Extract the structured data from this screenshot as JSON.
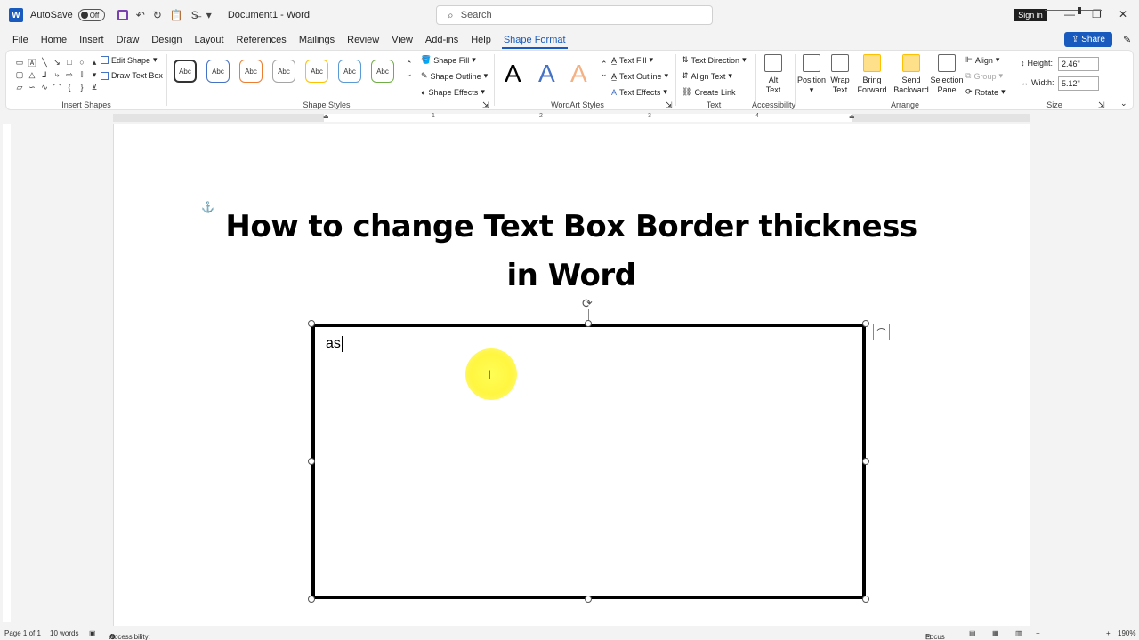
{
  "titlebar": {
    "autosave_label": "AutoSave",
    "autosave_state": "Off",
    "doc_title": "Document1 - Word",
    "search_placeholder": "Search",
    "sign_in": "Sign in"
  },
  "tabs": [
    "File",
    "Home",
    "Insert",
    "Draw",
    "Design",
    "Layout",
    "References",
    "Mailings",
    "Review",
    "View",
    "Add-ins",
    "Help",
    "Shape Format"
  ],
  "active_tab": "Shape Format",
  "share_label": "Share",
  "ribbon": {
    "insert_shapes": {
      "label": "Insert Shapes",
      "edit_shape": "Edit Shape",
      "draw_text_box": "Draw Text Box"
    },
    "shape_styles": {
      "label": "Shape Styles",
      "gallery": [
        "Abc",
        "Abc",
        "Abc",
        "Abc",
        "Abc",
        "Abc",
        "Abc"
      ],
      "shape_fill": "Shape Fill",
      "shape_outline": "Shape Outline",
      "shape_effects": "Shape Effects"
    },
    "wordart_styles": {
      "label": "WordArt Styles",
      "letters": [
        "A",
        "A",
        "A"
      ],
      "text_fill": "Text Fill",
      "text_outline": "Text Outline",
      "text_effects": "Text Effects"
    },
    "text": {
      "label": "Text",
      "text_direction": "Text Direction",
      "align_text": "Align Text",
      "create_link": "Create Link"
    },
    "accessibility": {
      "label": "Accessibility",
      "alt_text": "Alt Text"
    },
    "arrange": {
      "label": "Arrange",
      "position": "Position",
      "wrap_text": "Wrap Text",
      "bring_forward": "Bring Forward",
      "send_backward": "Send Backward",
      "selection_pane": "Selection Pane",
      "align": "Align",
      "group": "Group",
      "rotate": "Rotate"
    },
    "size": {
      "label": "Size",
      "height_label": "Height:",
      "height_value": "2.46\"",
      "width_label": "Width:",
      "width_value": "5.12\""
    }
  },
  "ruler_numbers": [
    "1",
    "2",
    "3",
    "4"
  ],
  "document": {
    "heading": "How to change Text Box Border thickness in Word",
    "textbox_text": "as"
  },
  "status": {
    "page": "Page 1 of 1",
    "words": "10 words",
    "accessibility": "Accessibility: Investigate",
    "focus": "Focus",
    "zoom": "190%"
  },
  "colors": {
    "accent": "#185abd",
    "style_borders": [
      "#333333",
      "#4472c4",
      "#ed7d31",
      "#a5a5a5",
      "#ffc000",
      "#5b9bd5",
      "#70ad47"
    ],
    "wordart_colors": [
      "#000000",
      "#4472c4",
      "#f4b183"
    ],
    "highlight": "#fff640"
  }
}
